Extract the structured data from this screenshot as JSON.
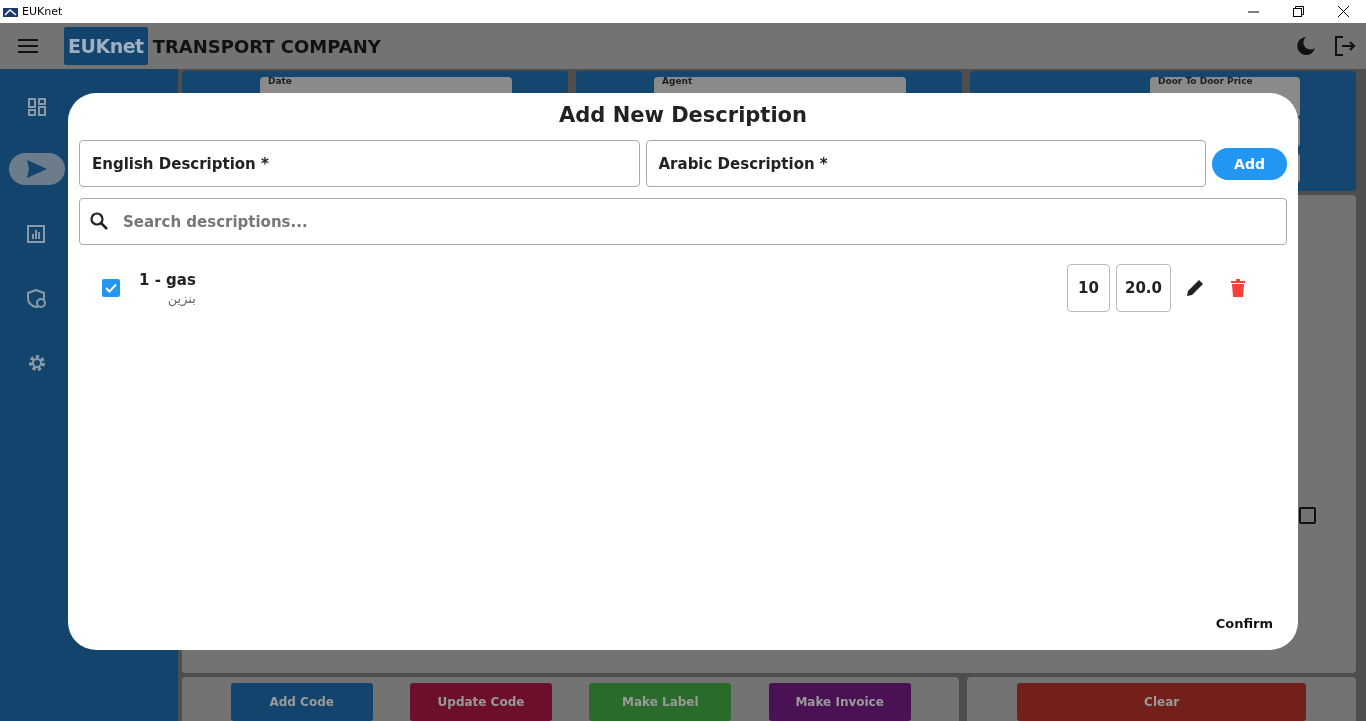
{
  "window": {
    "title": "EUKnet"
  },
  "app_bar": {
    "logo": "EUKnet",
    "title": "TRANSPORT COMPANY"
  },
  "sidebar": {
    "items": [
      {
        "kind": "dashboard",
        "selected": false
      },
      {
        "kind": "send",
        "selected": true
      },
      {
        "kind": "chart",
        "selected": false
      },
      {
        "kind": "shield",
        "selected": false
      },
      {
        "kind": "settings",
        "selected": false
      }
    ]
  },
  "form": {
    "fields": [
      {
        "label": "Date"
      },
      {
        "label": "Agent"
      },
      {
        "label": "Door To Door Price"
      }
    ],
    "checkbox": {
      "checked": false
    },
    "buttons": [
      {
        "label": "Add Code",
        "color": "#12446d"
      },
      {
        "label": "Update Code",
        "color": "#6b0f2b"
      },
      {
        "label": "Make Label",
        "color": "#2a6a2a"
      },
      {
        "label": "Make Invoice",
        "color": "#4a1254"
      },
      {
        "label": "Clear",
        "color": "#731f1a"
      }
    ]
  },
  "dialog": {
    "title": "Add New Description",
    "english_field": {
      "placeholder": "English Description *"
    },
    "arabic_field": {
      "placeholder": "Arabic Description *"
    },
    "add_button": "Add",
    "search": {
      "placeholder": "Search descriptions..."
    },
    "items": [
      {
        "checked": true,
        "title": "1 - gas",
        "arabic": "بنزين",
        "quantity": "10",
        "price": "20.0"
      }
    ],
    "confirm_button": "Confirm"
  }
}
